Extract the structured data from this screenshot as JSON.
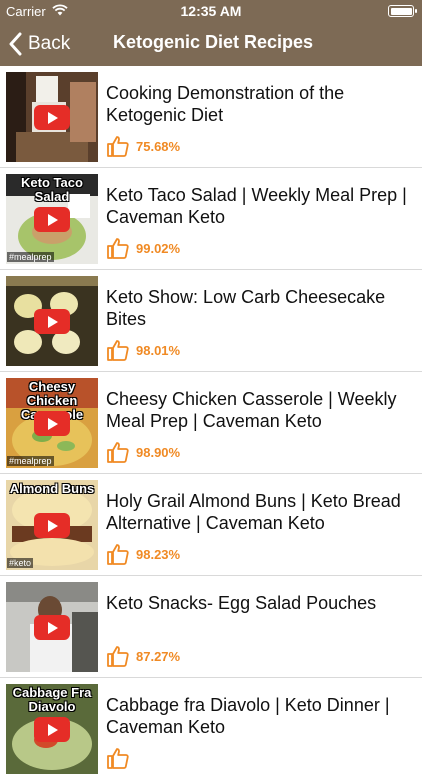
{
  "status_bar": {
    "carrier": "Carrier",
    "time": "12:35 AM"
  },
  "nav": {
    "back_label": "Back",
    "title": "Ketogenic Diet Recipes"
  },
  "colors": {
    "nav_bar": "#7d6a55",
    "rating": "#f08a24",
    "play": "#e52d27"
  },
  "videos": [
    {
      "title": "Cooking Demonstration of the Ketogenic Diet",
      "rating": "75.68%",
      "thumb_text": "",
      "thumb_tag": ""
    },
    {
      "title": "Keto Taco Salad | Weekly Meal Prep | Caveman Keto",
      "rating": "99.02%",
      "thumb_text": "Keto Taco Salad",
      "thumb_tag": "#mealprep"
    },
    {
      "title": "Keto Show: Low Carb Cheesecake Bites",
      "rating": "98.01%",
      "thumb_text": "",
      "thumb_tag": ""
    },
    {
      "title": "Cheesy Chicken Casserole | Weekly Meal Prep | Caveman Keto",
      "rating": "98.90%",
      "thumb_text": "Cheesy Chicken Casserole",
      "thumb_tag": "#mealprep"
    },
    {
      "title": "Holy Grail Almond Buns | Keto Bread Alternative | Caveman Keto",
      "rating": "98.23%",
      "thumb_text": "Almond Buns",
      "thumb_tag": "#keto"
    },
    {
      "title": "Keto Snacks- Egg Salad Pouches",
      "rating": "87.27%",
      "thumb_text": "",
      "thumb_tag": ""
    },
    {
      "title": "Cabbage fra Diavolo | Keto Dinner | Caveman Keto",
      "rating": "",
      "thumb_text": "Cabbage Fra Diavolo",
      "thumb_tag": ""
    }
  ]
}
